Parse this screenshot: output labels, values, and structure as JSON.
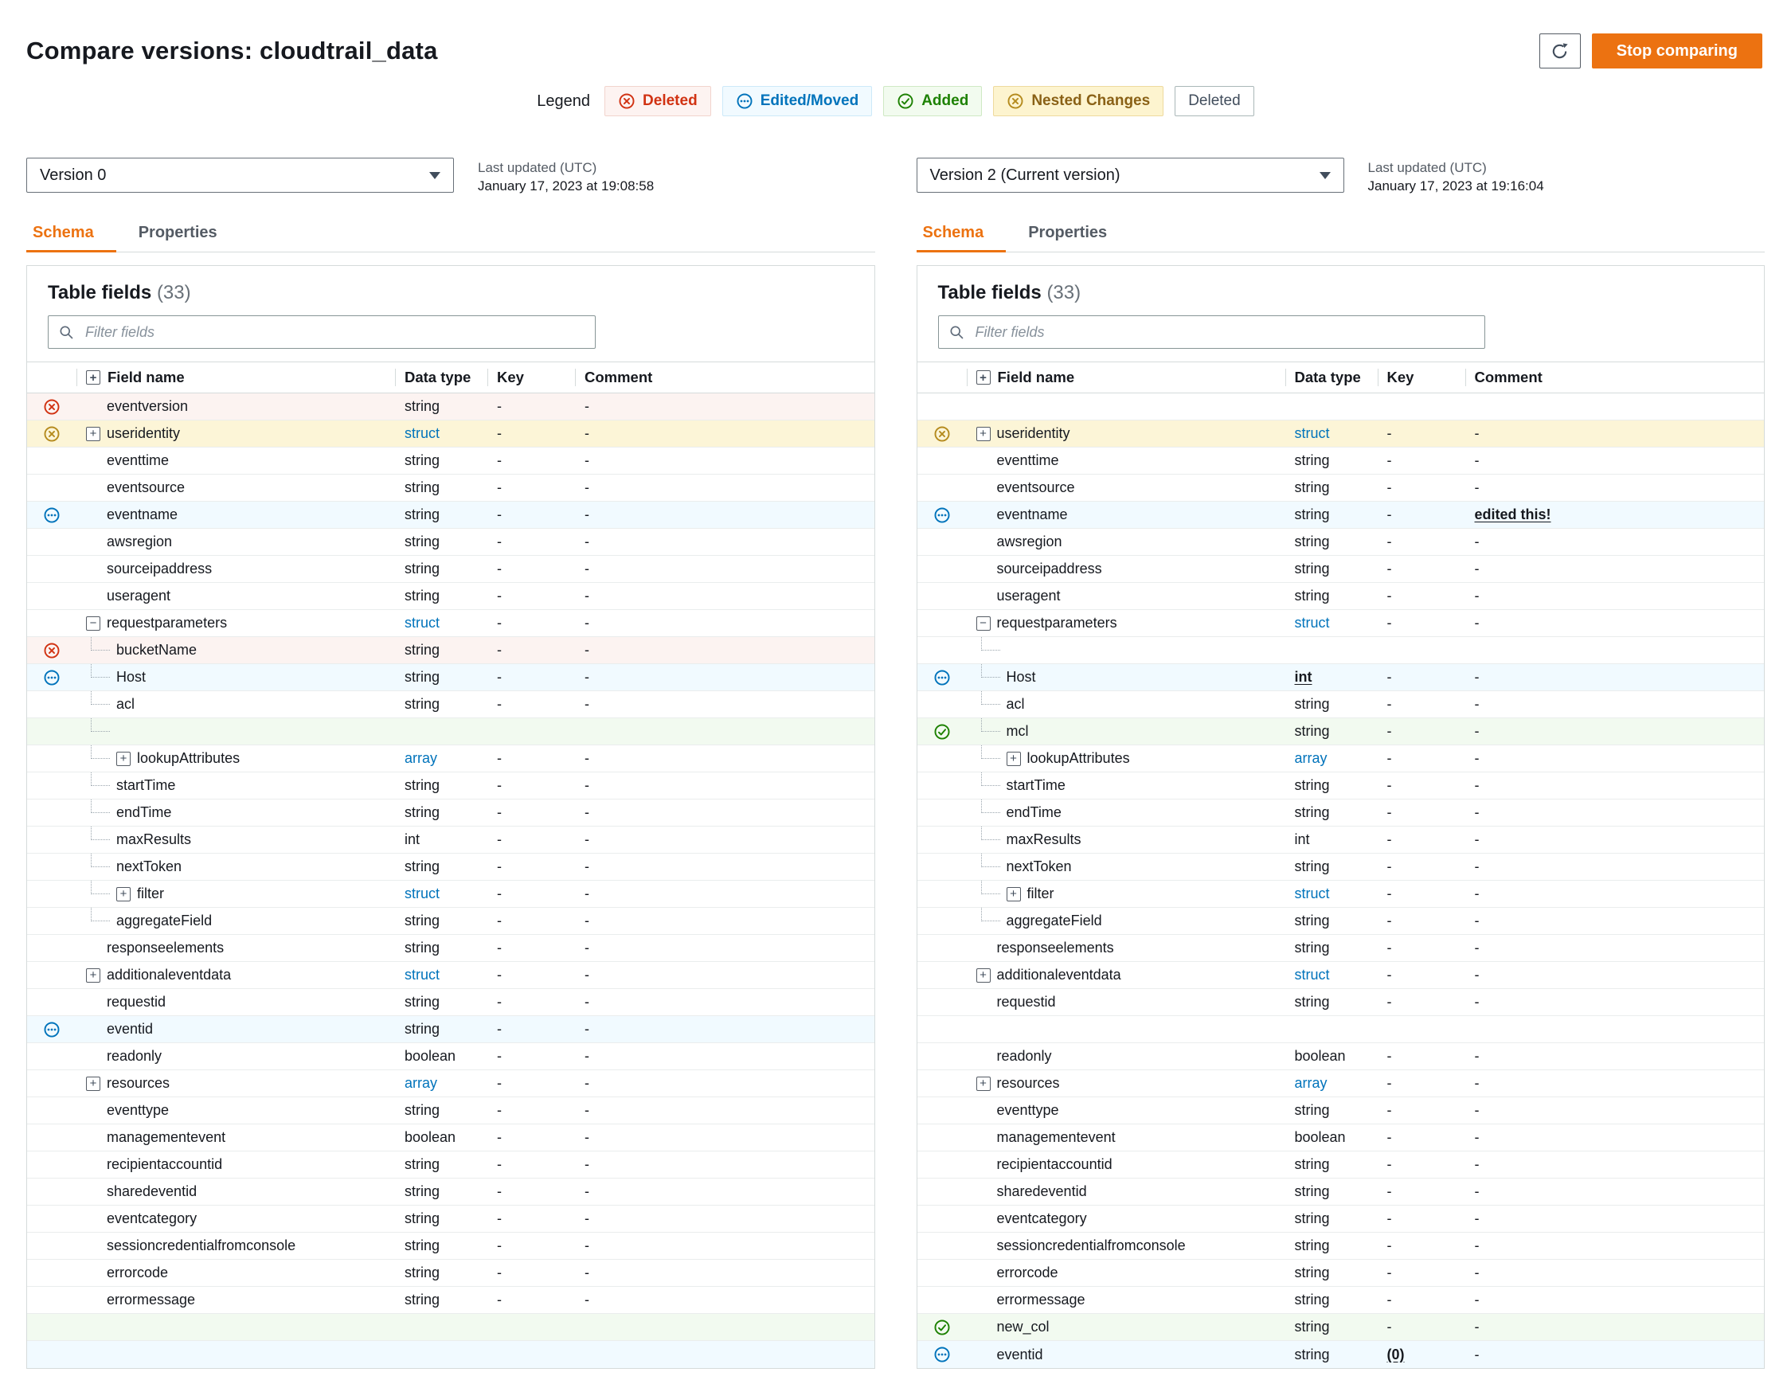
{
  "header": {
    "title": "Compare versions: cloudtrail_data",
    "stop_button": "Stop comparing"
  },
  "legend": {
    "label": "Legend",
    "items": [
      {
        "label": "Deleted",
        "kind": "deleted",
        "colors": {
          "text": "#d13212",
          "bg": "#fdf3f1",
          "border": "#f2d4cd"
        }
      },
      {
        "label": "Edited/Moved",
        "kind": "edited",
        "colors": {
          "text": "#0073bb",
          "bg": "#f1faff",
          "border": "#cde9f9"
        }
      },
      {
        "label": "Added",
        "kind": "added",
        "colors": {
          "text": "#1d8102",
          "bg": "#f2fbef",
          "border": "#cfe9c4"
        }
      },
      {
        "label": "Nested Changes",
        "kind": "nested",
        "colors": {
          "text": "#8a6116",
          "bg": "#fdf4cf",
          "border": "#eeda9e"
        }
      },
      {
        "label": "Deleted",
        "kind": "plain",
        "colors": {
          "text": "#414d5c",
          "bg": "#ffffff",
          "border": "#aab7b8"
        }
      }
    ]
  },
  "colors": {
    "accent": "#ec7211",
    "link": "#0073bb",
    "status": {
      "deleted": "#d13212",
      "edited": "#0073bb",
      "added": "#1d8102",
      "nested": "#b58b1e"
    },
    "row_bg": {
      "deleted": "#fcf3f1",
      "edited": "#f1faff",
      "added": "#f2faf0",
      "nested": "#fcf5d7"
    }
  },
  "tabs": [
    "Schema",
    "Properties"
  ],
  "table": {
    "title": "Table fields",
    "count": "(33)",
    "filter_placeholder": "Filter fields",
    "columns": [
      "Field name",
      "Data type",
      "Key",
      "Comment"
    ]
  },
  "panels": [
    {
      "version": "Version 0",
      "updated_label": "Last updated (UTC)",
      "updated": "January 17, 2023 at 19:08:58",
      "rows": [
        {
          "name": "eventversion",
          "type": "string",
          "key": "-",
          "comment": "-",
          "status": "deleted"
        },
        {
          "name": "useridentity",
          "type": "struct",
          "type_link": true,
          "key": "-",
          "comment": "-",
          "status": "nested",
          "expand": "plus"
        },
        {
          "name": "eventtime",
          "type": "string",
          "key": "-",
          "comment": "-"
        },
        {
          "name": "eventsource",
          "type": "string",
          "key": "-",
          "comment": "-"
        },
        {
          "name": "eventname",
          "type": "string",
          "key": "-",
          "comment": "-",
          "status": "edited"
        },
        {
          "name": "awsregion",
          "type": "string",
          "key": "-",
          "comment": "-"
        },
        {
          "name": "sourceipaddress",
          "type": "string",
          "key": "-",
          "comment": "-"
        },
        {
          "name": "useragent",
          "type": "string",
          "key": "-",
          "comment": "-"
        },
        {
          "name": "requestparameters",
          "type": "struct",
          "type_link": true,
          "key": "-",
          "comment": "-",
          "expand": "minus"
        },
        {
          "name": "bucketName",
          "type": "string",
          "key": "-",
          "comment": "-",
          "status": "deleted",
          "level": 1
        },
        {
          "name": "Host",
          "type": "string",
          "key": "-",
          "comment": "-",
          "status": "edited",
          "level": 1
        },
        {
          "name": "acl",
          "type": "string",
          "key": "-",
          "comment": "-",
          "level": 1
        },
        {
          "empty": true,
          "status": "added",
          "level": 1
        },
        {
          "name": "lookupAttributes",
          "type": "array",
          "type_link": true,
          "key": "-",
          "comment": "-",
          "level": 1,
          "expand": "plus"
        },
        {
          "name": "startTime",
          "type": "string",
          "key": "-",
          "comment": "-",
          "level": 1
        },
        {
          "name": "endTime",
          "type": "string",
          "key": "-",
          "comment": "-",
          "level": 1
        },
        {
          "name": "maxResults",
          "type": "int",
          "key": "-",
          "comment": "-",
          "level": 1
        },
        {
          "name": "nextToken",
          "type": "string",
          "key": "-",
          "comment": "-",
          "level": 1
        },
        {
          "name": "filter",
          "type": "struct",
          "type_link": true,
          "key": "-",
          "comment": "-",
          "level": 1,
          "expand": "plus"
        },
        {
          "name": "aggregateField",
          "type": "string",
          "key": "-",
          "comment": "-",
          "level": 1
        },
        {
          "name": "responseelements",
          "type": "string",
          "key": "-",
          "comment": "-"
        },
        {
          "name": "additionaleventdata",
          "type": "struct",
          "type_link": true,
          "key": "-",
          "comment": "-",
          "expand": "plus"
        },
        {
          "name": "requestid",
          "type": "string",
          "key": "-",
          "comment": "-"
        },
        {
          "name": "eventid",
          "type": "string",
          "key": "-",
          "comment": "-",
          "status": "edited"
        },
        {
          "name": "readonly",
          "type": "boolean",
          "key": "-",
          "comment": "-"
        },
        {
          "name": "resources",
          "type": "array",
          "type_link": true,
          "key": "-",
          "comment": "-",
          "expand": "plus"
        },
        {
          "name": "eventtype",
          "type": "string",
          "key": "-",
          "comment": "-"
        },
        {
          "name": "managementevent",
          "type": "boolean",
          "key": "-",
          "comment": "-"
        },
        {
          "name": "recipientaccountid",
          "type": "string",
          "key": "-",
          "comment": "-"
        },
        {
          "name": "sharedeventid",
          "type": "string",
          "key": "-",
          "comment": "-"
        },
        {
          "name": "eventcategory",
          "type": "string",
          "key": "-",
          "comment": "-"
        },
        {
          "name": "sessioncredentialfromconsole",
          "type": "string",
          "key": "-",
          "comment": "-"
        },
        {
          "name": "errorcode",
          "type": "string",
          "key": "-",
          "comment": "-"
        },
        {
          "name": "errormessage",
          "type": "string",
          "key": "-",
          "comment": "-"
        },
        {
          "empty": true,
          "status": "added"
        },
        {
          "empty": true,
          "status": "edited"
        }
      ]
    },
    {
      "version": "Version 2 (Current version)",
      "updated_label": "Last updated (UTC)",
      "updated": "January 17, 2023 at 19:16:04",
      "rows": [
        {
          "empty": true
        },
        {
          "name": "useridentity",
          "type": "struct",
          "type_link": true,
          "key": "-",
          "comment": "-",
          "status": "nested",
          "expand": "plus"
        },
        {
          "name": "eventtime",
          "type": "string",
          "key": "-",
          "comment": "-"
        },
        {
          "name": "eventsource",
          "type": "string",
          "key": "-",
          "comment": "-"
        },
        {
          "name": "eventname",
          "type": "string",
          "key": "-",
          "comment": "edited this!",
          "comment_emph": true,
          "status": "edited"
        },
        {
          "name": "awsregion",
          "type": "string",
          "key": "-",
          "comment": "-"
        },
        {
          "name": "sourceipaddress",
          "type": "string",
          "key": "-",
          "comment": "-"
        },
        {
          "name": "useragent",
          "type": "string",
          "key": "-",
          "comment": "-"
        },
        {
          "name": "requestparameters",
          "type": "struct",
          "type_link": true,
          "key": "-",
          "comment": "-",
          "expand": "minus"
        },
        {
          "empty": true,
          "level": 1
        },
        {
          "name": "Host",
          "type": "int",
          "type_emph": true,
          "key": "-",
          "comment": "-",
          "status": "edited",
          "level": 1
        },
        {
          "name": "acl",
          "type": "string",
          "key": "-",
          "comment": "-",
          "level": 1
        },
        {
          "name": "mcl",
          "type": "string",
          "key": "-",
          "comment": "-",
          "status": "added",
          "level": 1
        },
        {
          "name": "lookupAttributes",
          "type": "array",
          "type_link": true,
          "key": "-",
          "comment": "-",
          "level": 1,
          "expand": "plus"
        },
        {
          "name": "startTime",
          "type": "string",
          "key": "-",
          "comment": "-",
          "level": 1
        },
        {
          "name": "endTime",
          "type": "string",
          "key": "-",
          "comment": "-",
          "level": 1
        },
        {
          "name": "maxResults",
          "type": "int",
          "key": "-",
          "comment": "-",
          "level": 1
        },
        {
          "name": "nextToken",
          "type": "string",
          "key": "-",
          "comment": "-",
          "level": 1
        },
        {
          "name": "filter",
          "type": "struct",
          "type_link": true,
          "key": "-",
          "comment": "-",
          "level": 1,
          "expand": "plus"
        },
        {
          "name": "aggregateField",
          "type": "string",
          "key": "-",
          "comment": "-",
          "level": 1
        },
        {
          "name": "responseelements",
          "type": "string",
          "key": "-",
          "comment": "-"
        },
        {
          "name": "additionaleventdata",
          "type": "struct",
          "type_link": true,
          "key": "-",
          "comment": "-",
          "expand": "plus"
        },
        {
          "name": "requestid",
          "type": "string",
          "key": "-",
          "comment": "-"
        },
        {
          "empty": true
        },
        {
          "name": "readonly",
          "type": "boolean",
          "key": "-",
          "comment": "-"
        },
        {
          "name": "resources",
          "type": "array",
          "type_link": true,
          "key": "-",
          "comment": "-",
          "expand": "plus"
        },
        {
          "name": "eventtype",
          "type": "string",
          "key": "-",
          "comment": "-"
        },
        {
          "name": "managementevent",
          "type": "boolean",
          "key": "-",
          "comment": "-"
        },
        {
          "name": "recipientaccountid",
          "type": "string",
          "key": "-",
          "comment": "-"
        },
        {
          "name": "sharedeventid",
          "type": "string",
          "key": "-",
          "comment": "-"
        },
        {
          "name": "eventcategory",
          "type": "string",
          "key": "-",
          "comment": "-"
        },
        {
          "name": "sessioncredentialfromconsole",
          "type": "string",
          "key": "-",
          "comment": "-"
        },
        {
          "name": "errorcode",
          "type": "string",
          "key": "-",
          "comment": "-"
        },
        {
          "name": "errormessage",
          "type": "string",
          "key": "-",
          "comment": "-"
        },
        {
          "name": "new_col",
          "type": "string",
          "key": "-",
          "comment": "-",
          "status": "added"
        },
        {
          "name": "eventid",
          "type": "string",
          "key": "(0)",
          "key_emph": true,
          "comment": "-",
          "status": "edited"
        }
      ]
    }
  ]
}
